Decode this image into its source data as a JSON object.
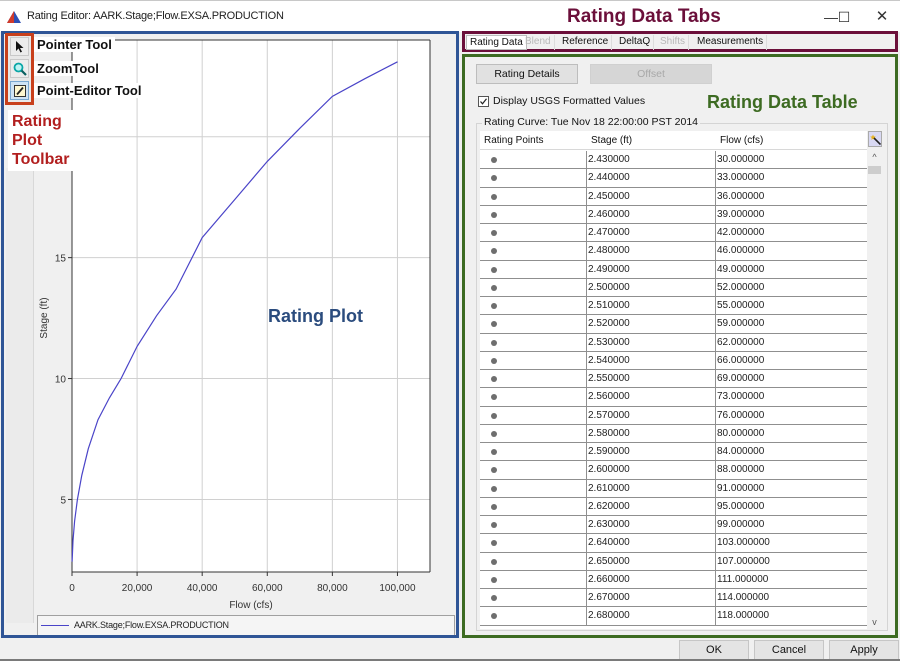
{
  "window": {
    "title": "Rating Editor: AARK.Stage;Flow.EXSA.PRODUCTION",
    "controls": {
      "minimize": "—",
      "maximize": "☐",
      "close": "✕"
    }
  },
  "annotations": {
    "tabs": "Rating Data Tabs",
    "table": "Rating Data Table",
    "plot": "Rating Plot",
    "toolbar": [
      "Rating",
      "Plot",
      "Toolbar"
    ]
  },
  "toolbar": {
    "tools": [
      {
        "label": "Pointer Tool",
        "icon": "pointer-arrow-icon",
        "active": false
      },
      {
        "label": "ZoomTool",
        "icon": "magnifier-icon",
        "active": false
      },
      {
        "label": "Point-Editor Tool",
        "icon": "pencil-icon",
        "active": true
      }
    ]
  },
  "tabs": [
    {
      "label": "Rating Data",
      "state": "active"
    },
    {
      "label": "Blend",
      "state": "disabled"
    },
    {
      "label": "Reference",
      "state": "enabled"
    },
    {
      "label": "DeltaQ",
      "state": "enabled"
    },
    {
      "label": "Shifts",
      "state": "disabled"
    },
    {
      "label": "Measurements",
      "state": "enabled"
    }
  ],
  "data_panel": {
    "rating_details_label": "Rating Details",
    "offset_label": "Offset",
    "display_usgs_label": "Display USGS Formatted Values",
    "display_usgs_checked": true,
    "rating_curve_label": "Rating Curve: Tue Nov 18 22:00:00 PST 2014",
    "columns": [
      "Rating Points",
      "Stage (ft)",
      "Flow (cfs)"
    ],
    "rows": [
      [
        "2.430000",
        "30.000000"
      ],
      [
        "2.440000",
        "33.000000"
      ],
      [
        "2.450000",
        "36.000000"
      ],
      [
        "2.460000",
        "39.000000"
      ],
      [
        "2.470000",
        "42.000000"
      ],
      [
        "2.480000",
        "46.000000"
      ],
      [
        "2.490000",
        "49.000000"
      ],
      [
        "2.500000",
        "52.000000"
      ],
      [
        "2.510000",
        "55.000000"
      ],
      [
        "2.520000",
        "59.000000"
      ],
      [
        "2.530000",
        "62.000000"
      ],
      [
        "2.540000",
        "66.000000"
      ],
      [
        "2.550000",
        "69.000000"
      ],
      [
        "2.560000",
        "73.000000"
      ],
      [
        "2.570000",
        "76.000000"
      ],
      [
        "2.580000",
        "80.000000"
      ],
      [
        "2.590000",
        "84.000000"
      ],
      [
        "2.600000",
        "88.000000"
      ],
      [
        "2.610000",
        "91.000000"
      ],
      [
        "2.620000",
        "95.000000"
      ],
      [
        "2.630000",
        "99.000000"
      ],
      [
        "2.640000",
        "103.000000"
      ],
      [
        "2.650000",
        "107.000000"
      ],
      [
        "2.660000",
        "111.000000"
      ],
      [
        "2.670000",
        "114.000000"
      ],
      [
        "2.680000",
        "118.000000"
      ]
    ],
    "scroll_up": "^",
    "scroll_down": "v"
  },
  "footer": {
    "ok_label": "OK",
    "cancel_label": "Cancel",
    "apply_label": "Apply"
  },
  "colors": {
    "plot_frame": "#2f5596",
    "toolbar_frame": "#c8401c",
    "tabs_frame": "#6b0f3a",
    "table_frame": "#3d6b22",
    "series": "#4a44c8"
  },
  "chart_data": {
    "type": "line",
    "title": "",
    "xlabel": "Flow (cfs)",
    "ylabel": "Stage (ft)",
    "xlim": [
      0,
      110000
    ],
    "ylim": [
      2.0,
      24.0
    ],
    "grid": true,
    "legend_position": "bottom",
    "x_ticks": [
      0,
      20000,
      40000,
      60000,
      80000,
      100000
    ],
    "x_tick_labels": [
      "0",
      "20,000",
      "40,000",
      "60,000",
      "80,000",
      "100,000"
    ],
    "y_ticks": [
      5,
      10,
      15,
      20
    ],
    "y_tick_labels": [
      "5",
      "10",
      "15",
      ""
    ],
    "series": [
      {
        "name": "AARK.Stage;Flow.EXSA.PRODUCTION",
        "x": [
          30,
          300,
          800,
          1650,
          3000,
          5000,
          8000,
          11500,
          15100,
          20000,
          26000,
          32000,
          40000,
          50000,
          60000,
          70000,
          80000,
          90000,
          100000
        ],
        "y": [
          2.43,
          3.3,
          4.1,
          5.0,
          6.0,
          7.1,
          8.3,
          9.2,
          10.0,
          11.33,
          12.6,
          13.7,
          15.83,
          17.4,
          18.98,
          20.35,
          21.67,
          22.4,
          23.1
        ]
      }
    ]
  }
}
